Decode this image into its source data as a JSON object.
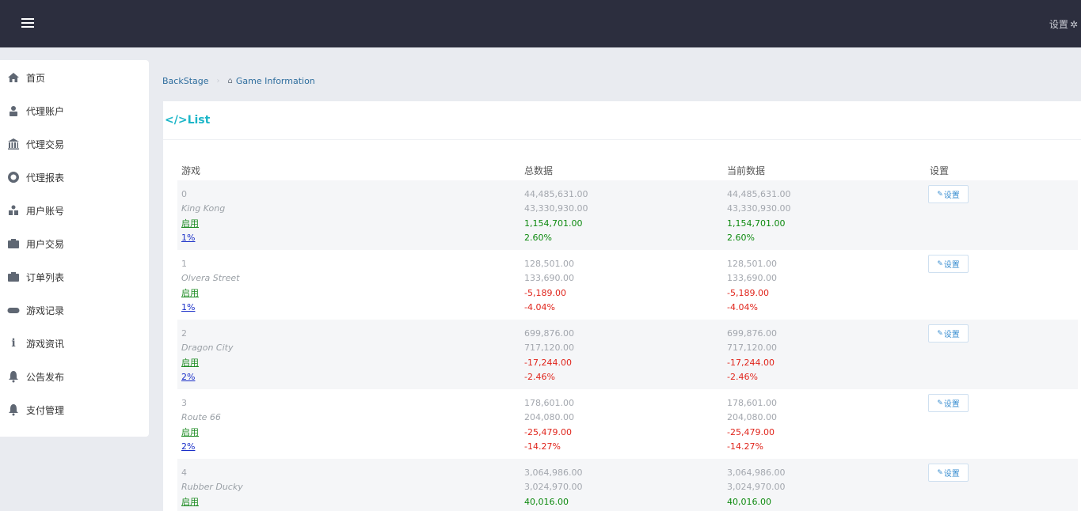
{
  "header": {
    "settings_label": "设置",
    "menu_icon": "list-icon",
    "settings_icon": "gear-icon"
  },
  "sidebar": {
    "items": [
      {
        "label": "首页",
        "icon": "home-icon"
      },
      {
        "label": "代理账户",
        "icon": "user-lock-icon"
      },
      {
        "label": "代理交易",
        "icon": "bank-icon"
      },
      {
        "label": "代理报表",
        "icon": "lifebuoy-icon"
      },
      {
        "label": "用户账号",
        "icon": "users-icon"
      },
      {
        "label": "用户交易",
        "icon": "briefcase-icon"
      },
      {
        "label": "订单列表",
        "icon": "briefcase-icon"
      },
      {
        "label": "游戏记录",
        "icon": "gamepad-icon"
      },
      {
        "label": "游戏资讯",
        "icon": "info-icon"
      },
      {
        "label": "公告发布",
        "icon": "bell-icon"
      },
      {
        "label": "支付管理",
        "icon": "bell-icon"
      }
    ]
  },
  "breadcrumb": {
    "root": "BackStage",
    "current": "Game Information"
  },
  "panel": {
    "title": "</>List"
  },
  "table": {
    "headers": [
      "游戏",
      "总数据",
      "当前数据",
      "设置"
    ],
    "edit_label": "设置",
    "rows": [
      {
        "id": "0",
        "name": "King Kong",
        "status": "启用",
        "rate": "1%",
        "total_a": "44,485,631.00",
        "total_b": "43,330,930.00",
        "total_diff": "1,154,701.00",
        "total_pct": "2.60%",
        "cur_a": "44,485,631.00",
        "cur_b": "43,330,930.00",
        "cur_diff": "1,154,701.00",
        "cur_pct": "2.60%",
        "sign": "pos"
      },
      {
        "id": "1",
        "name": "Olvera Street",
        "status": "启用",
        "rate": "1%",
        "total_a": "128,501.00",
        "total_b": "133,690.00",
        "total_diff": "-5,189.00",
        "total_pct": "-4.04%",
        "cur_a": "128,501.00",
        "cur_b": "133,690.00",
        "cur_diff": "-5,189.00",
        "cur_pct": "-4.04%",
        "sign": "neg"
      },
      {
        "id": "2",
        "name": "Dragon City",
        "status": "启用",
        "rate": "2%",
        "total_a": "699,876.00",
        "total_b": "717,120.00",
        "total_diff": "-17,244.00",
        "total_pct": "-2.46%",
        "cur_a": "699,876.00",
        "cur_b": "717,120.00",
        "cur_diff": "-17,244.00",
        "cur_pct": "-2.46%",
        "sign": "neg"
      },
      {
        "id": "3",
        "name": "Route 66",
        "status": "启用",
        "rate": "2%",
        "total_a": "178,601.00",
        "total_b": "204,080.00",
        "total_diff": "-25,479.00",
        "total_pct": "-14.27%",
        "cur_a": "178,601.00",
        "cur_b": "204,080.00",
        "cur_diff": "-25,479.00",
        "cur_pct": "-14.27%",
        "sign": "neg"
      },
      {
        "id": "4",
        "name": "Rubber Ducky",
        "status": "启用",
        "rate": "",
        "total_a": "3,064,986.00",
        "total_b": "3,024,970.00",
        "total_diff": "40,016.00",
        "total_pct": "",
        "cur_a": "3,064,986.00",
        "cur_b": "3,024,970.00",
        "cur_diff": "40,016.00",
        "cur_pct": "",
        "sign": "pos"
      }
    ]
  }
}
